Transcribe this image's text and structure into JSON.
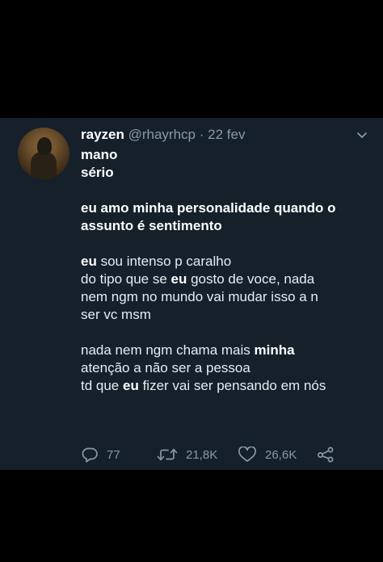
{
  "tweet": {
    "author": {
      "name": "rayzen",
      "handle": "@rhayrhcp",
      "separator": "·",
      "date": "22 fev"
    },
    "lines": {
      "l1": "mano",
      "l2": "sério",
      "l3": "eu amo minha personalidade quando o",
      "l4": "assunto é sentimento",
      "l5_a": "eu",
      "l5_b": " sou intenso p caralho",
      "l6_a": "do tipo que se ",
      "l6_b": "eu",
      "l6_c": " gosto de voce, nada",
      "l7": "nem ngm no mundo vai mudar isso a n",
      "l8": "ser vc msm",
      "l9_a": "nada nem ngm chama mais ",
      "l9_b": "minha",
      "l10": "atenção a não ser a pessoa",
      "l11_a": "td que ",
      "l11_b": "eu",
      "l11_c": " fizer vai ser pensando em nós"
    },
    "stats": {
      "replies": "77",
      "retweets": "21,8K",
      "likes": "26,6K"
    },
    "icons": {
      "reply": "speech-bubble-icon",
      "retweet": "retweet-arrows-icon",
      "like": "heart-icon",
      "share": "share-icon",
      "menu": "chevron-down-icon"
    },
    "colors": {
      "background": "#15202b",
      "text": "#e6ecf0",
      "muted": "#8899a6",
      "page": "#000000"
    }
  }
}
